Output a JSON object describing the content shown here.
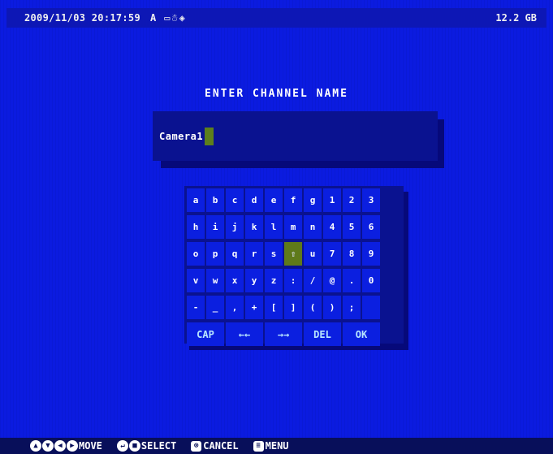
{
  "topbar": {
    "timestamp": "2009/11/03 20:17:59",
    "mode": "A",
    "status_icons": [
      "▭",
      "☃",
      "◈"
    ],
    "disk": "12.2 GB"
  },
  "dialog": {
    "title": "ENTER CHANNEL NAME",
    "name_value": "Camera1"
  },
  "keyboard": {
    "rows": [
      [
        "a",
        "b",
        "c",
        "d",
        "e",
        "f",
        "g",
        "1",
        "2",
        "3"
      ],
      [
        "h",
        "i",
        "j",
        "k",
        "l",
        "m",
        "n",
        "4",
        "5",
        "6"
      ],
      [
        "o",
        "p",
        "q",
        "r",
        "s",
        "⇧",
        "u",
        "7",
        "8",
        "9"
      ],
      [
        "v",
        "w",
        "x",
        "y",
        "z",
        ":",
        "/",
        "@",
        ".",
        "0"
      ],
      [
        "-",
        "_",
        ",",
        "+",
        "[",
        "]",
        "(",
        ")",
        ";",
        ""
      ]
    ],
    "selected_key": "⇧",
    "function_keys": [
      "CAP",
      "←←",
      "→→",
      "DEL",
      "OK"
    ]
  },
  "bottombar": {
    "hints": [
      {
        "icons": [
          "▲",
          "▼",
          "◀",
          "▶"
        ],
        "label": "MOVE"
      },
      {
        "icons": [
          "↵",
          "■"
        ],
        "label": "SELECT"
      },
      {
        "icons": [
          "⊗"
        ],
        "label": "CANCEL"
      },
      {
        "icons": [
          "≡"
        ],
        "label": "MENU"
      }
    ]
  }
}
